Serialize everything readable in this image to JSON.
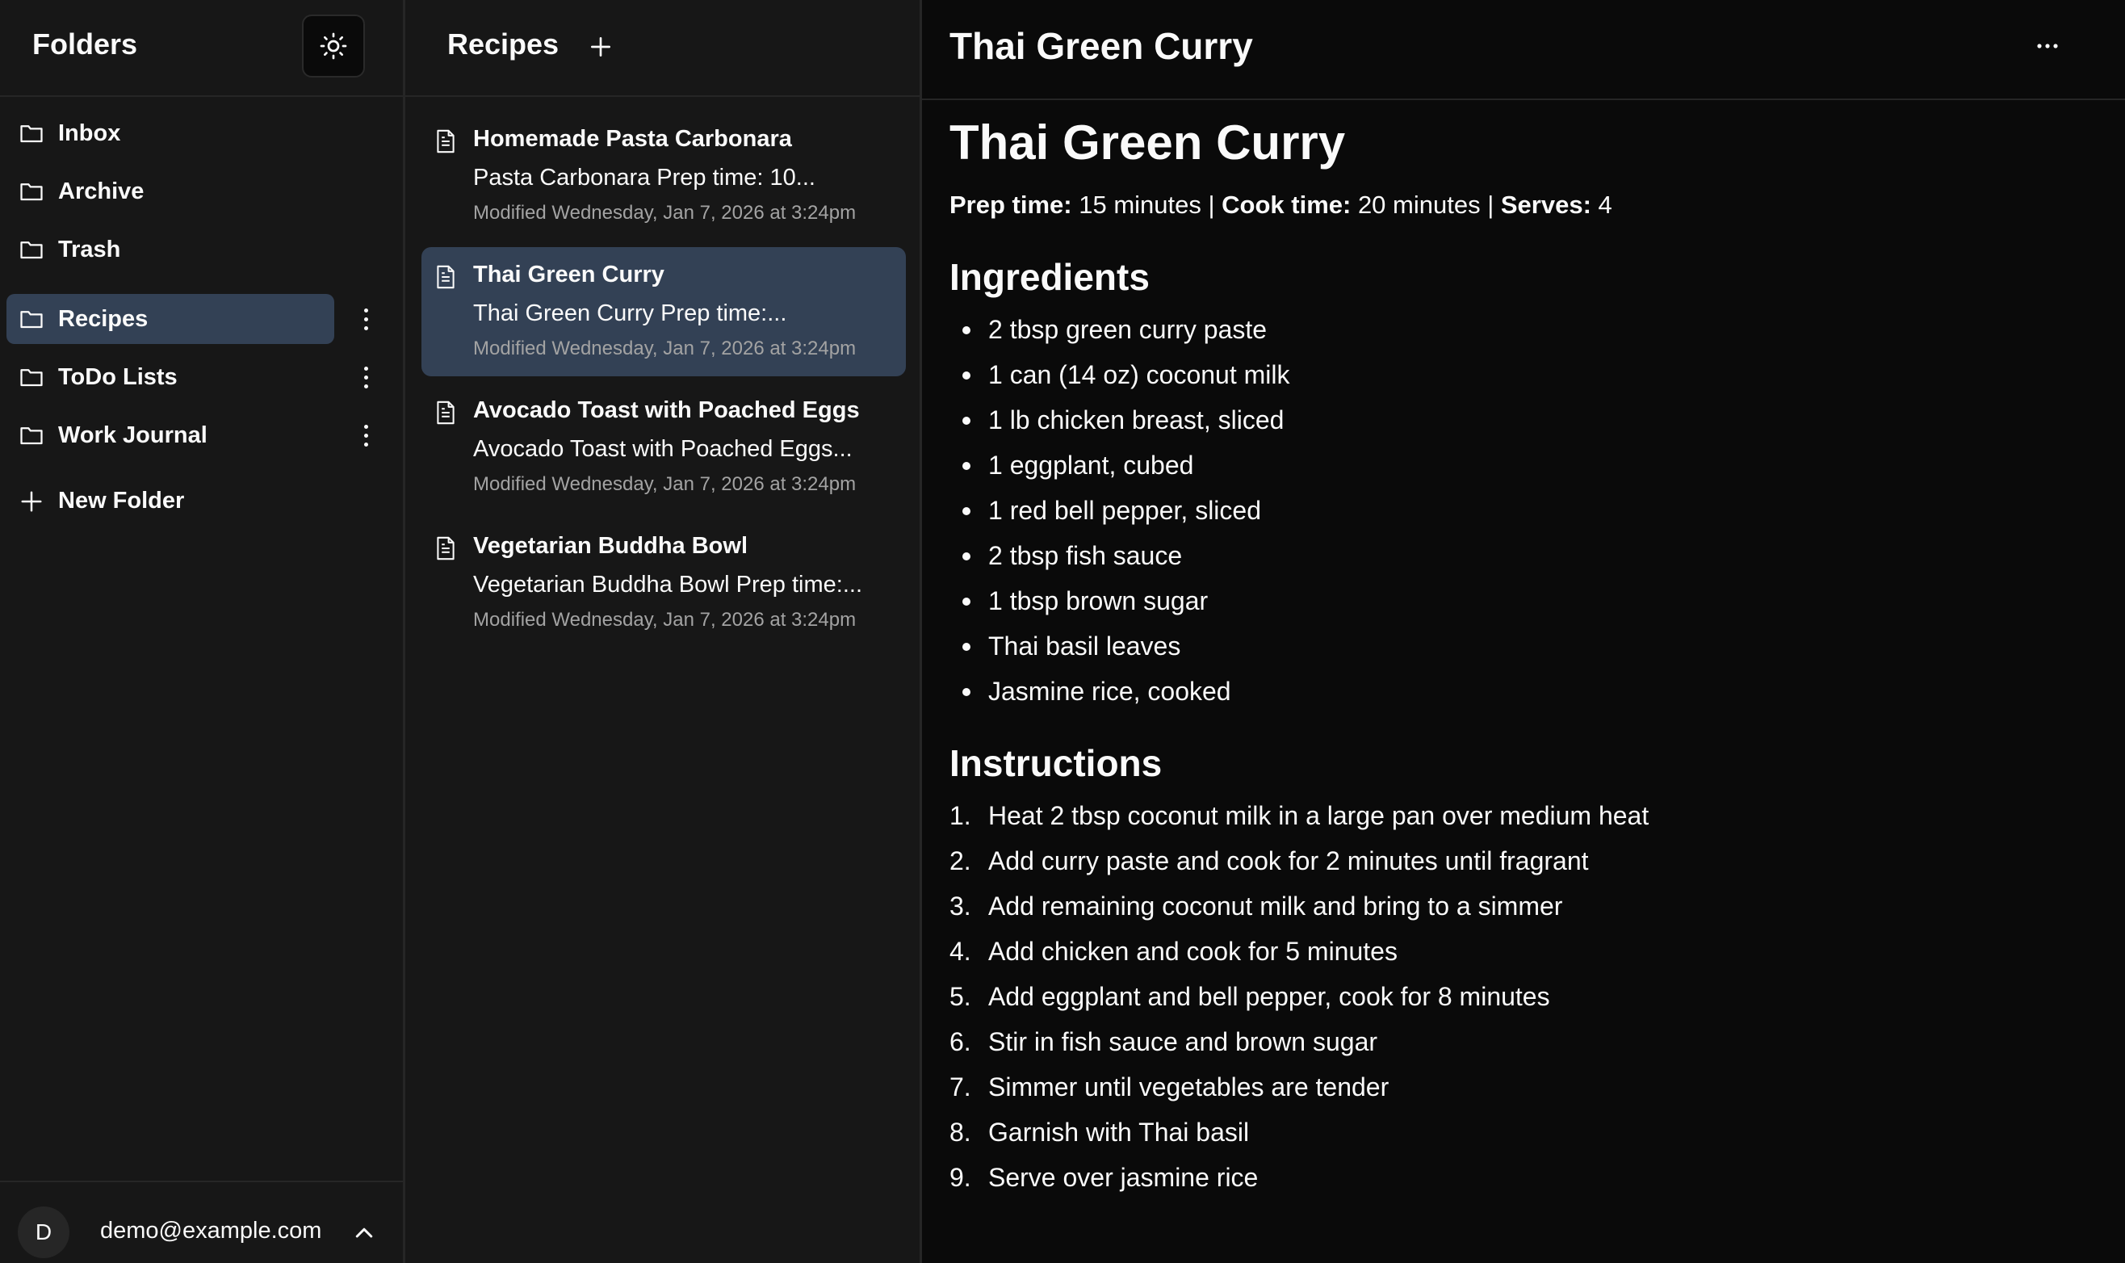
{
  "sidebar": {
    "title": "Folders",
    "folders": [
      {
        "label": "Inbox",
        "active": false,
        "has_menu": false
      },
      {
        "label": "Archive",
        "active": false,
        "has_menu": false
      },
      {
        "label": "Trash",
        "active": false,
        "has_menu": false
      },
      {
        "label": "Recipes",
        "active": true,
        "has_menu": true
      },
      {
        "label": "ToDo Lists",
        "active": false,
        "has_menu": true
      },
      {
        "label": "Work Journal",
        "active": false,
        "has_menu": true
      }
    ],
    "new_folder_label": "New Folder",
    "user": {
      "avatar_initial": "D",
      "email": "demo@example.com"
    }
  },
  "notes_list": {
    "title": "Recipes",
    "notes": [
      {
        "title": "Homemade Pasta Carbonara",
        "preview": "Pasta Carbonara Prep time: 10...",
        "modified": "Modified Wednesday, Jan 7, 2026 at 3:24pm",
        "active": false
      },
      {
        "title": "Thai Green Curry",
        "preview": "Thai Green Curry Prep time:...",
        "modified": "Modified Wednesday, Jan 7, 2026 at 3:24pm",
        "active": true
      },
      {
        "title": "Avocado Toast with Poached Eggs",
        "preview": "Avocado Toast with Poached Eggs...",
        "modified": "Modified Wednesday, Jan 7, 2026 at 3:24pm",
        "active": false
      },
      {
        "title": "Vegetarian Buddha Bowl",
        "preview": "Vegetarian Buddha Bowl Prep time:...",
        "modified": "Modified Wednesday, Jan 7, 2026 at 3:24pm",
        "active": false
      }
    ]
  },
  "editor": {
    "header_title": "Thai Green Curry",
    "doc_title": "Thai Green Curry",
    "meta": {
      "prep_label": "Prep time:",
      "prep_value": " 15 minutes | ",
      "cook_label": "Cook time:",
      "cook_value": " 20 minutes | ",
      "serves_label": "Serves:",
      "serves_value": " 4"
    },
    "ingredients_heading": "Ingredients",
    "ingredients": [
      "2 tbsp green curry paste",
      "1 can (14 oz) coconut milk",
      "1 lb chicken breast, sliced",
      "1 eggplant, cubed",
      "1 red bell pepper, sliced",
      "2 tbsp fish sauce",
      "1 tbsp brown sugar",
      "Thai basil leaves",
      "Jasmine rice, cooked"
    ],
    "instructions_heading": "Instructions",
    "instructions": [
      {
        "num": "1.",
        "text": "Heat 2 tbsp coconut milk in a large pan over medium heat"
      },
      {
        "num": "2.",
        "text": "Add curry paste and cook for 2 minutes until fragrant"
      },
      {
        "num": "3.",
        "text": "Add remaining coconut milk and bring to a simmer"
      },
      {
        "num": "4.",
        "text": "Add chicken and cook for 5 minutes"
      },
      {
        "num": "5.",
        "text": "Add eggplant and bell pepper, cook for 8 minutes"
      },
      {
        "num": "6.",
        "text": "Stir in fish sauce and brown sugar"
      },
      {
        "num": "7.",
        "text": "Simmer until vegetables are tender"
      },
      {
        "num": "8.",
        "text": "Garnish with Thai basil"
      },
      {
        "num": "9.",
        "text": "Serve over jasmine rice"
      }
    ]
  },
  "icons": {
    "theme_toggle": "sun-icon",
    "folder": "folder-icon",
    "kebab": "more-vertical-icon",
    "plus": "plus-icon",
    "note": "file-text-icon",
    "chevron": "chevron-up-icon",
    "editor_more": "more-horizontal-icon"
  },
  "colors": {
    "background": "#0a0a0a",
    "panel": "#171717",
    "border": "#262626",
    "selected": "#334155",
    "text": "#fafafa",
    "muted_text": "#a3a3a3"
  }
}
